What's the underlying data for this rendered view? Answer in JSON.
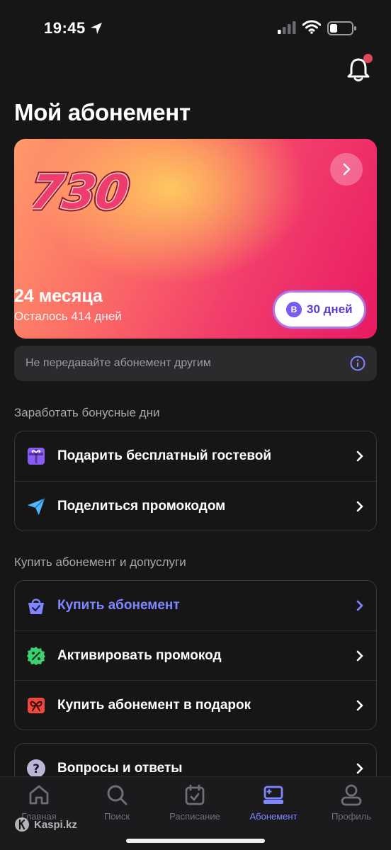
{
  "status_bar": {
    "time": "19:45"
  },
  "header": {
    "title": "Мой абонемент"
  },
  "card": {
    "logo_text": "730",
    "term": "24 месяца",
    "remaining": "Осталось 414 дней",
    "bonus_badge": "30 дней",
    "bonus_icon_letter": "B"
  },
  "notice": {
    "text": "Не передавайте абонемент другим"
  },
  "sections": {
    "bonus": {
      "title": "Заработать бонусные дни",
      "items": [
        {
          "label": "Подарить бесплатный гостевой",
          "icon": "gift-icon",
          "color": "#8a5cf6"
        },
        {
          "label": "Поделиться промокодом",
          "icon": "send-icon",
          "color": "#4fb6ff"
        }
      ]
    },
    "buy": {
      "title": "Купить абонемент и допуслуги",
      "items": [
        {
          "label": "Купить абонемент",
          "icon": "shopping-bag-icon",
          "color": "#7f86ff"
        },
        {
          "label": "Активировать промокод",
          "icon": "discount-icon",
          "color": "#3bd16f"
        },
        {
          "label": "Купить абонемент в подарок",
          "icon": "gift-bow-icon",
          "color": "#f0473f"
        }
      ]
    },
    "help": {
      "items": [
        {
          "label": "Вопросы и ответы",
          "icon": "question-icon",
          "color": "#b9b6d6"
        }
      ]
    }
  },
  "tab_bar": {
    "tabs": [
      {
        "label": "Главная",
        "icon": "home-icon"
      },
      {
        "label": "Поиск",
        "icon": "search-icon"
      },
      {
        "label": "Расписание",
        "icon": "calendar-icon"
      },
      {
        "label": "Абонемент",
        "icon": "membership-icon",
        "active": true
      },
      {
        "label": "Профиль",
        "icon": "profile-icon"
      }
    ]
  },
  "watermark": {
    "text": "Kaspi.kz"
  },
  "colors": {
    "accent": "#7f86ff",
    "background": "#161617",
    "badge_dot": "#e0475a"
  }
}
